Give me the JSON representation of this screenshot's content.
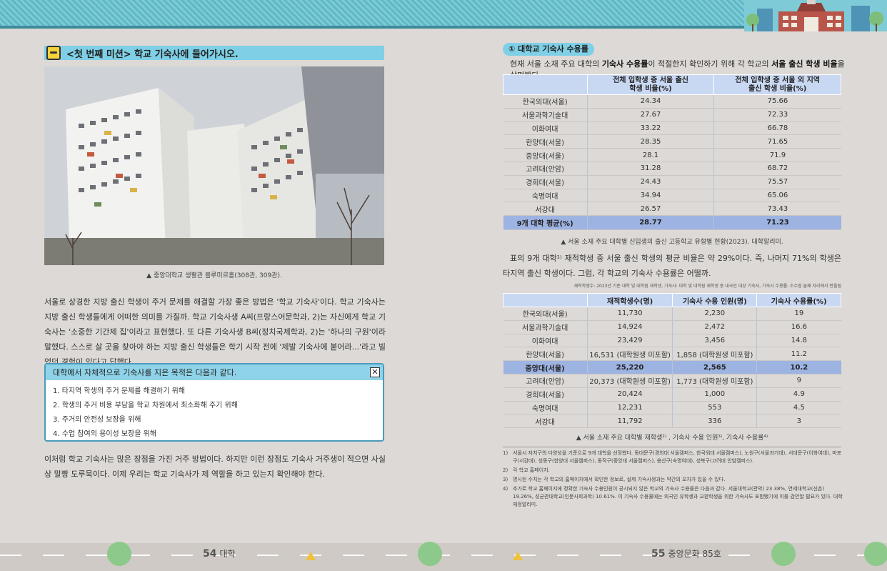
{
  "left": {
    "mission_title": "<첫 번째 미션> 학교 기숙사에 들어가시오.",
    "photo_caption": "▲ 중앙대학교 생활관 블루미르홀(308관, 309관).",
    "para1": "서울로 상경한 지방 출신 학생이 주거 문제를 해결할 가장 좋은 방법은 '학교 기숙사'이다. 학교 기숙사는 지방 출신 학생들에게 어떠한 의미를 가질까. 학교 기숙사생 A씨(프랑스어문학과, 2)는 자신에게 학교 기숙사는 '소중한 기간제 집'이라고 표현했다. 또 다른 기숙사생 B씨(정치국제학과, 2)는 '하나의 구원'이라 말했다. 스스로 살 곳을 찾아야 하는 지방 출신 학생들은 학기 시작 전에 '제발 기숙사에 붙어라...'라고 빌었던 경험이 있다고 답했다.",
    "box": {
      "title": "대학에서 자체적으로 기숙사를 지은 목적은 다음과 같다.",
      "items": [
        "1. 타지역 학생의 주거 문제를 해결하기 위해",
        "2. 학생의 주거 비용 부담을 학교 차원에서 최소화해 주기 위해",
        "3. 주거의 안전성 보장을 위해",
        "4. 수업 참여의 용이성 보장을 위해"
      ]
    },
    "para2": "이처럼 학교 기숙사는 많은 장점을 가진 거주 방법이다. 하지만 이런 장점도 기숙사 거주생이 적으면 사실상 말짱 도루묵이다. 이제 우리는 학교 기숙사가 제 역할을 하고 있는지 확인해야 한다.",
    "page_number": "54",
    "page_label": "대학"
  },
  "right": {
    "section_title": "① 대학교 기숙사 수용률",
    "intro_a": "현재 서울 소재 주요 대학의 ",
    "intro_b": "기숙사 수용률",
    "intro_c": "이 적절한지 확인하기 위해 각 학교의 ",
    "intro_d": "서울 출신 학생 비율",
    "intro_e": "을 살펴봤다.",
    "table1": {
      "headers": [
        "",
        "전체 입학생 중 서울 출신\n학생 비율(%)",
        "전체 입학생 중 서울 외 지역\n출신 학생 비율(%)"
      ],
      "rows": [
        [
          "한국외대(서울)",
          "24.34",
          "75.66"
        ],
        [
          "서울과학기술대",
          "27.67",
          "72.33"
        ],
        [
          "이화여대",
          "33.22",
          "66.78"
        ],
        [
          "한양대(서울)",
          "28.35",
          "71.65"
        ],
        [
          "중앙대(서울)",
          "28.1",
          "71.9"
        ],
        [
          "고려대(안암)",
          "31.28",
          "68.72"
        ],
        [
          "경희대(서울)",
          "24.43",
          "75.57"
        ],
        [
          "숙명여대",
          "34.94",
          "65.06"
        ],
        [
          "서강대",
          "26.57",
          "73.43"
        ]
      ],
      "avg": [
        "9개 대학 평균(%)",
        "28.77",
        "71.23"
      ],
      "caption": "▲ 서울 소재 주요 대학별 신입생의 출신 고등학교 유형별 현황(2023). 대학알리미."
    },
    "para3": "표의 9개 대학¹⁾ 재적학생 중 서울 출신 학생의 평균 비율은 약 29%이다. 즉, 나머지 71%의 학생은 타지역 출신 학생이다. 그럼, 각 학교의 기숙사 수용률은 어떨까.",
    "source_note": "재적학생수: 2023년 기준 대학 및 대학원 재학생, 기숙사: 대학 및 대학원 재학생 중 내국인 대상 기숙사, 기숙사 수용률: 소수점 둘째 자리에서 반올림",
    "table2": {
      "headers": [
        "",
        "재적학생수(명)",
        "기숙사 수용 인원(명)",
        "기숙사 수용률(%)"
      ],
      "rows": [
        [
          "한국외대(서울)",
          "11,730",
          "2,230",
          "19"
        ],
        [
          "서울과학기술대",
          "14,924",
          "2,472",
          "16.6"
        ],
        [
          "이화여대",
          "23,429",
          "3,456",
          "14.8"
        ],
        [
          "한양대(서울)",
          "16,531 (대학원생 미포함)",
          "1,858 (대학원생 미포함)",
          "11.2"
        ],
        [
          "중앙대(서울)",
          "25,220",
          "2,565",
          "10.2"
        ],
        [
          "고려대(안암)",
          "20,373 (대학원생 미포함)",
          "1,773 (대학원생 미포함)",
          "9"
        ],
        [
          "경희대(서울)",
          "20,424",
          "1,000",
          "4.9"
        ],
        [
          "숙명여대",
          "12,231",
          "553",
          "4.5"
        ],
        [
          "서강대",
          "11,792",
          "336",
          "3"
        ]
      ],
      "caption": "▲ 서울 소재 주요 대학별 재학생²⁾ , 기숙사 수용 인원³⁾, 기숙사 수용률⁴⁾"
    },
    "notes": [
      {
        "n": "1)",
        "t": "서울시 자치구의 다양성을 기준으로 9개 대학을 선정했다. 동대문구(경희대 서울캠퍼스, 한국외대 서울캠퍼스), 노원구(서울과기대), 서대문구(이화여대), 마포구(서강대), 성동구(한양대 서울캠퍼스), 동작구(중앙대 서울캠퍼스), 용산구(숙명여대), 성북구(고려대 안암캠퍼스)."
      },
      {
        "n": "2)",
        "t": "각 학교 홈페이지."
      },
      {
        "n": "3)",
        "t": "명시된 수치는 각 학교의 홈페이지에서 확인한 정보로, 실제 기숙사생과는 약간의 오차가 있을 수 있다."
      },
      {
        "n": "4)",
        "t": "추가로 학교 홈페이지에 정확한 기숙사 수용인원이 공시되지 않은 학교의 기숙사 수용률은 다음과 같다. 서울대학교(관악) 23.38%, 연세대학교(신촌) 19.26%, 성균관대학교(인문사회과학) 10.61%. 이 기숙사 수용률에는 외국인 유학생과 교환학생을 위한 기숙사도 포함됐기에 이를 감안할 필요가 있다. 대학재정알리미."
      }
    ],
    "page_number": "55",
    "page_label": "중앙문화 85호"
  }
}
